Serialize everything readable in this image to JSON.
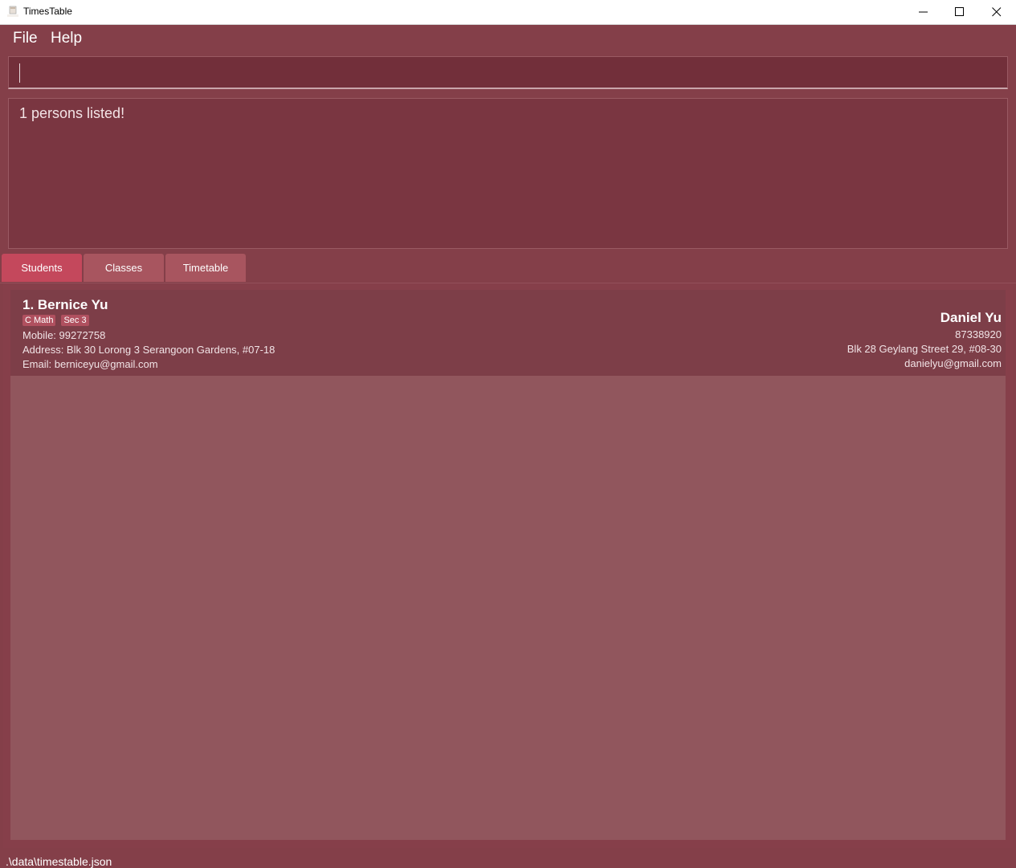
{
  "window": {
    "title": "TimesTable",
    "icon": "app-icon",
    "controls": [
      "minimize-icon",
      "maximize-icon",
      "close-icon"
    ]
  },
  "menu": {
    "items": [
      {
        "label": "File"
      },
      {
        "label": "Help"
      }
    ]
  },
  "command_box": {
    "value": ""
  },
  "result_display": {
    "text": "1 persons listed!"
  },
  "tabs": [
    {
      "label": "Students",
      "active": true
    },
    {
      "label": "Classes",
      "active": false
    },
    {
      "label": "Timetable",
      "active": false
    }
  ],
  "students": [
    {
      "index_name": "1.  Bernice Yu",
      "tags": [
        "C Math",
        "Sec 3"
      ],
      "mobile": "Mobile: 99272758",
      "address": "Address: Blk 30 Lorong 3 Serangoon Gardens, #07-18",
      "email": "Email: berniceyu@gmail.com",
      "guardian": {
        "name": "Daniel Yu",
        "phone": "87338920",
        "address": "Blk 28 Geylang Street 29, #08-30",
        "email": "danielyu@gmail.com"
      }
    }
  ],
  "status_bar": {
    "path": ".\\data\\timestable.json"
  },
  "colors": {
    "background": "#843f49",
    "active_tab": "#c4485c",
    "tab": "#a8555f",
    "card": "#7d3e48",
    "empty_list": "#91565d"
  }
}
